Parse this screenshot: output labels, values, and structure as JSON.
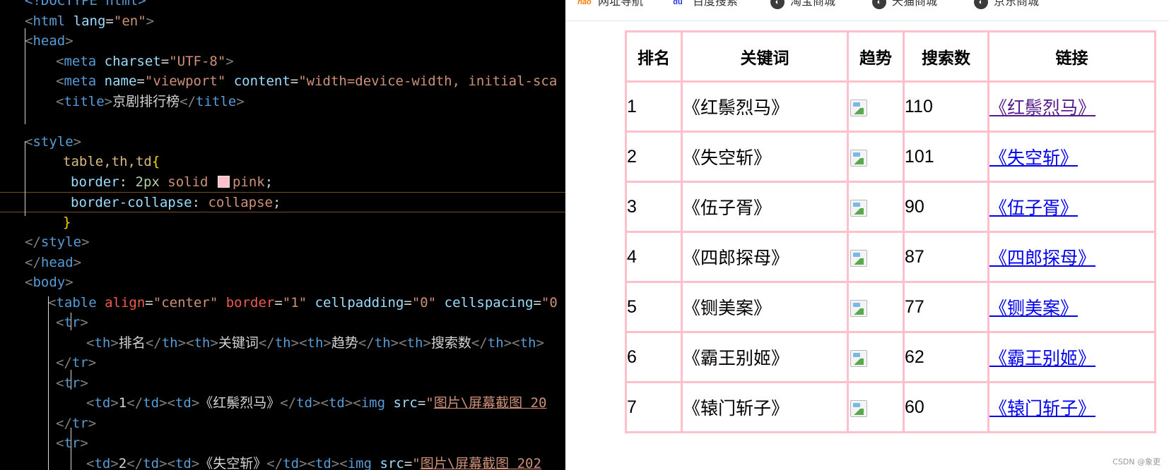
{
  "editor": {
    "lines": [
      {
        "id": "l0",
        "segments": [
          {
            "t": "<!DOCTYPE html>",
            "c": "t-tag"
          }
        ]
      },
      {
        "id": "l1",
        "segments": [
          {
            "t": "<",
            "c": "t-punc"
          },
          {
            "t": "html",
            "c": "t-tag"
          },
          {
            "t": " lang",
            "c": "t-attr"
          },
          {
            "t": "=",
            "c": "t-text"
          },
          {
            "t": "\"en\"",
            "c": "t-str"
          },
          {
            "t": ">",
            "c": "t-punc"
          }
        ]
      },
      {
        "id": "l2",
        "segments": [
          {
            "t": "<",
            "c": "t-punc"
          },
          {
            "t": "head",
            "c": "t-tag"
          },
          {
            "t": ">",
            "c": "t-punc"
          }
        ]
      },
      {
        "id": "l3",
        "segments": [
          {
            "t": "<",
            "c": "t-punc"
          },
          {
            "t": "meta",
            "c": "t-tag"
          },
          {
            "t": " charset",
            "c": "t-attr"
          },
          {
            "t": "=",
            "c": "t-text"
          },
          {
            "t": "\"UTF-8\"",
            "c": "t-str"
          },
          {
            "t": ">",
            "c": "t-punc"
          }
        ]
      },
      {
        "id": "l4",
        "segments": [
          {
            "t": "<",
            "c": "t-punc"
          },
          {
            "t": "meta",
            "c": "t-tag"
          },
          {
            "t": " name",
            "c": "t-attr"
          },
          {
            "t": "=",
            "c": "t-text"
          },
          {
            "t": "\"viewport\"",
            "c": "t-str"
          },
          {
            "t": " content",
            "c": "t-attr"
          },
          {
            "t": "=",
            "c": "t-text"
          },
          {
            "t": "\"width=device-width, initial-sca",
            "c": "t-str"
          }
        ]
      },
      {
        "id": "l5",
        "segments": [
          {
            "t": "<",
            "c": "t-punc"
          },
          {
            "t": "title",
            "c": "t-tag"
          },
          {
            "t": ">",
            "c": "t-punc"
          },
          {
            "t": "京剧排行榜",
            "c": "t-text"
          },
          {
            "t": "</",
            "c": "t-punc"
          },
          {
            "t": "title",
            "c": "t-tag"
          },
          {
            "t": ">",
            "c": "t-punc"
          }
        ]
      },
      {
        "id": "l6",
        "segments": []
      },
      {
        "id": "l7",
        "segments": [
          {
            "t": "<",
            "c": "t-punc"
          },
          {
            "t": "style",
            "c": "t-tag"
          },
          {
            "t": ">",
            "c": "t-punc"
          }
        ]
      },
      {
        "id": "l8",
        "segments": [
          {
            "t": "table,th,td",
            "c": "t-sel"
          },
          {
            "t": "{",
            "c": "t-brace"
          }
        ]
      },
      {
        "id": "l9",
        "segments": [
          {
            "t": "border",
            "c": "t-prop"
          },
          {
            "t": ": ",
            "c": "t-text"
          },
          {
            "t": "2px",
            "c": "t-num"
          },
          {
            "t": " solid ",
            "c": "t-val"
          },
          {
            "t": "SWATCH",
            "c": "swatch"
          },
          {
            "t": "pink",
            "c": "t-val"
          },
          {
            "t": ";",
            "c": "t-text"
          }
        ]
      },
      {
        "id": "l10",
        "segments": [
          {
            "t": "border-collapse",
            "c": "t-prop"
          },
          {
            "t": ": ",
            "c": "t-text"
          },
          {
            "t": "collapse",
            "c": "t-val"
          },
          {
            "t": ";",
            "c": "t-text"
          }
        ]
      },
      {
        "id": "l11",
        "segments": [
          {
            "t": "}",
            "c": "t-brace"
          }
        ]
      },
      {
        "id": "l12",
        "segments": [
          {
            "t": "</",
            "c": "t-punc"
          },
          {
            "t": "style",
            "c": "t-tag"
          },
          {
            "t": ">",
            "c": "t-punc"
          }
        ]
      },
      {
        "id": "l13",
        "segments": [
          {
            "t": "</",
            "c": "t-punc"
          },
          {
            "t": "head",
            "c": "t-tag"
          },
          {
            "t": ">",
            "c": "t-punc"
          }
        ]
      },
      {
        "id": "l14",
        "segments": [
          {
            "t": "<",
            "c": "t-punc"
          },
          {
            "t": "body",
            "c": "t-tag"
          },
          {
            "t": ">",
            "c": "t-punc"
          }
        ]
      },
      {
        "id": "l15",
        "segments": [
          {
            "t": "<",
            "c": "t-punc"
          },
          {
            "t": "table",
            "c": "t-tag"
          },
          {
            "t": " align",
            "c": "t-attr-r"
          },
          {
            "t": "=",
            "c": "t-text"
          },
          {
            "t": "\"center\"",
            "c": "t-str"
          },
          {
            "t": " border",
            "c": "t-attr-r"
          },
          {
            "t": "=",
            "c": "t-text"
          },
          {
            "t": "\"1\"",
            "c": "t-str"
          },
          {
            "t": " cellpadding",
            "c": "t-attr"
          },
          {
            "t": "=",
            "c": "t-text"
          },
          {
            "t": "\"0\"",
            "c": "t-str"
          },
          {
            "t": " cellspacing",
            "c": "t-attr"
          },
          {
            "t": "=",
            "c": "t-text"
          },
          {
            "t": "\"0",
            "c": "t-str"
          }
        ]
      },
      {
        "id": "l16",
        "segments": [
          {
            "t": "<",
            "c": "t-punc"
          },
          {
            "t": "tr",
            "c": "t-tag"
          },
          {
            "t": ">",
            "c": "t-punc"
          }
        ]
      },
      {
        "id": "l17",
        "segments": [
          {
            "t": "<",
            "c": "t-punc"
          },
          {
            "t": "th",
            "c": "t-tag"
          },
          {
            "t": ">",
            "c": "t-punc"
          },
          {
            "t": "排名",
            "c": "t-text"
          },
          {
            "t": "</",
            "c": "t-punc"
          },
          {
            "t": "th",
            "c": "t-tag"
          },
          {
            "t": "><",
            "c": "t-punc"
          },
          {
            "t": "th",
            "c": "t-tag"
          },
          {
            "t": ">",
            "c": "t-punc"
          },
          {
            "t": "关键词",
            "c": "t-text"
          },
          {
            "t": "</",
            "c": "t-punc"
          },
          {
            "t": "th",
            "c": "t-tag"
          },
          {
            "t": "><",
            "c": "t-punc"
          },
          {
            "t": "th",
            "c": "t-tag"
          },
          {
            "t": ">",
            "c": "t-punc"
          },
          {
            "t": "趋势",
            "c": "t-text"
          },
          {
            "t": "</",
            "c": "t-punc"
          },
          {
            "t": "th",
            "c": "t-tag"
          },
          {
            "t": "><",
            "c": "t-punc"
          },
          {
            "t": "th",
            "c": "t-tag"
          },
          {
            "t": ">",
            "c": "t-punc"
          },
          {
            "t": "搜索数",
            "c": "t-text"
          },
          {
            "t": "</",
            "c": "t-punc"
          },
          {
            "t": "th",
            "c": "t-tag"
          },
          {
            "t": "><",
            "c": "t-punc"
          },
          {
            "t": "th",
            "c": "t-tag"
          },
          {
            "t": ">",
            "c": "t-punc"
          }
        ]
      },
      {
        "id": "l18",
        "segments": [
          {
            "t": "</",
            "c": "t-punc"
          },
          {
            "t": "tr",
            "c": "t-tag"
          },
          {
            "t": ">",
            "c": "t-punc"
          }
        ]
      },
      {
        "id": "l19",
        "segments": [
          {
            "t": "<",
            "c": "t-punc"
          },
          {
            "t": "tr",
            "c": "t-tag"
          },
          {
            "t": ">",
            "c": "t-punc"
          }
        ]
      },
      {
        "id": "l20",
        "segments": [
          {
            "t": "<",
            "c": "t-punc"
          },
          {
            "t": "td",
            "c": "t-tag"
          },
          {
            "t": ">",
            "c": "t-punc"
          },
          {
            "t": "1",
            "c": "t-text"
          },
          {
            "t": "</",
            "c": "t-punc"
          },
          {
            "t": "td",
            "c": "t-tag"
          },
          {
            "t": "><",
            "c": "t-punc"
          },
          {
            "t": "td",
            "c": "t-tag"
          },
          {
            "t": ">",
            "c": "t-punc"
          },
          {
            "t": "《红鬃烈马》",
            "c": "t-text"
          },
          {
            "t": "</",
            "c": "t-punc"
          },
          {
            "t": "td",
            "c": "t-tag"
          },
          {
            "t": "><",
            "c": "t-punc"
          },
          {
            "t": "td",
            "c": "t-tag"
          },
          {
            "t": "><",
            "c": "t-punc"
          },
          {
            "t": "img",
            "c": "t-tag"
          },
          {
            "t": " src",
            "c": "t-attr"
          },
          {
            "t": "=",
            "c": "t-text"
          },
          {
            "t": "\"",
            "c": "t-str"
          },
          {
            "t": "图片\\屏幕截图 20",
            "c": "t-str t-link"
          }
        ]
      },
      {
        "id": "l21",
        "segments": [
          {
            "t": "</",
            "c": "t-punc"
          },
          {
            "t": "tr",
            "c": "t-tag"
          },
          {
            "t": ">",
            "c": "t-punc"
          }
        ]
      },
      {
        "id": "l22",
        "segments": [
          {
            "t": "<",
            "c": "t-punc"
          },
          {
            "t": "tr",
            "c": "t-tag"
          },
          {
            "t": ">",
            "c": "t-punc"
          }
        ]
      },
      {
        "id": "l23",
        "segments": [
          {
            "t": "<",
            "c": "t-punc"
          },
          {
            "t": "td",
            "c": "t-tag"
          },
          {
            "t": ">",
            "c": "t-punc"
          },
          {
            "t": "2",
            "c": "t-text"
          },
          {
            "t": "</",
            "c": "t-punc"
          },
          {
            "t": "td",
            "c": "t-tag"
          },
          {
            "t": "><",
            "c": "t-punc"
          },
          {
            "t": "td",
            "c": "t-tag"
          },
          {
            "t": ">",
            "c": "t-punc"
          },
          {
            "t": "《失空斩》",
            "c": "t-text"
          },
          {
            "t": "</",
            "c": "t-punc"
          },
          {
            "t": "td",
            "c": "t-tag"
          },
          {
            "t": "><",
            "c": "t-punc"
          },
          {
            "t": "td",
            "c": "t-tag"
          },
          {
            "t": "><",
            "c": "t-punc"
          },
          {
            "t": "img",
            "c": "t-tag"
          },
          {
            "t": " src",
            "c": "t-attr"
          },
          {
            "t": "=",
            "c": "t-text"
          },
          {
            "t": "\"",
            "c": "t-str"
          },
          {
            "t": "图片\\屏幕截图 202",
            "c": "t-str t-link"
          }
        ]
      }
    ]
  },
  "browser": {
    "bookmarks": [
      {
        "icon": "hao",
        "label": "网址导航"
      },
      {
        "icon": "du",
        "label": "百度搜索"
      },
      {
        "icon": "globe",
        "label": "淘宝商城"
      },
      {
        "icon": "globe",
        "label": "天猫商城"
      },
      {
        "icon": "globe",
        "label": "京东商城"
      }
    ],
    "table": {
      "headers": [
        "排名",
        "关键词",
        "趋势",
        "搜索数",
        "链接"
      ],
      "rows": [
        {
          "rank": "1",
          "keyword": "《红鬃烈马》",
          "count": "110",
          "link": "《红鬃烈马》",
          "visited": true
        },
        {
          "rank": "2",
          "keyword": "《失空斩》",
          "count": "101",
          "link": "《失空斩》",
          "visited": false
        },
        {
          "rank": "3",
          "keyword": "《伍子胥》",
          "count": "90",
          "link": "《伍子胥》",
          "visited": false
        },
        {
          "rank": "4",
          "keyword": "《四郎探母》",
          "count": "87",
          "link": "《四郎探母》",
          "visited": false
        },
        {
          "rank": "5",
          "keyword": "《铡美案》",
          "count": "77",
          "link": "《铡美案》",
          "visited": false
        },
        {
          "rank": "6",
          "keyword": "《霸王别姬》",
          "count": "62",
          "link": "《霸王别姬》",
          "visited": false
        },
        {
          "rank": "7",
          "keyword": "《辕门斩子》",
          "count": "60",
          "link": "《辕门斩子》",
          "visited": false
        }
      ]
    },
    "watermark": "CSDN @象更"
  },
  "colors": {
    "editor_bg": "#000000",
    "table_border": "#ffc0cb",
    "visited_link": "#551a8b",
    "link": "#0000ee"
  }
}
